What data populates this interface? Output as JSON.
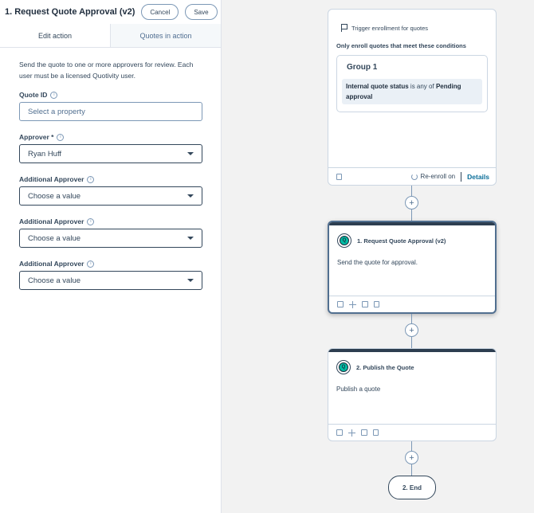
{
  "header": {
    "title": "1. Request Quote Approval (v2)",
    "cancel_label": "Cancel",
    "save_label": "Save"
  },
  "tabs": [
    {
      "label": "Edit action",
      "active": true
    },
    {
      "label": "Quotes in action",
      "active": false
    }
  ],
  "form": {
    "description": "Send the quote to one or more approvers for review. Each user must be a licensed Quotivity user.",
    "fields": [
      {
        "label": "Quote ID",
        "placeholder": "Select a property",
        "info_icon": "i"
      },
      {
        "label": "Approver *",
        "value": "Ryan Huff",
        "info_icon": "i"
      },
      {
        "label": "Additional Approver",
        "value": "Choose a value",
        "info_icon": "i"
      },
      {
        "label": "Additional Approver",
        "value": "Choose a value",
        "info_icon": "i"
      },
      {
        "label": "Additional Approver",
        "value": "Choose a value",
        "info_icon": "i"
      }
    ]
  },
  "workflow": {
    "trigger": {
      "title": "Trigger enrollment for quotes",
      "subtitle": "Only enroll quotes that meet these conditions",
      "group_title": "Group 1",
      "condition_property": "Internal quote status",
      "condition_operator": " is any of ",
      "condition_value": "Pending approval",
      "reenroll_label": "Re-enroll on",
      "details_label": "Details"
    },
    "actions": [
      {
        "title": "1. Request Quote Approval (v2)",
        "body": "Send the quote for approval.",
        "icon_letter": "Q"
      },
      {
        "title": "2. Publish the Quote",
        "body": "Publish a quote",
        "icon_letter": "Q"
      }
    ],
    "plus_glyph": "+",
    "end_label": "2. End"
  },
  "colors": {
    "accent_link": "#0b6e99",
    "app_icon": "#00bda5",
    "card_topbar": "#2d3e50"
  }
}
